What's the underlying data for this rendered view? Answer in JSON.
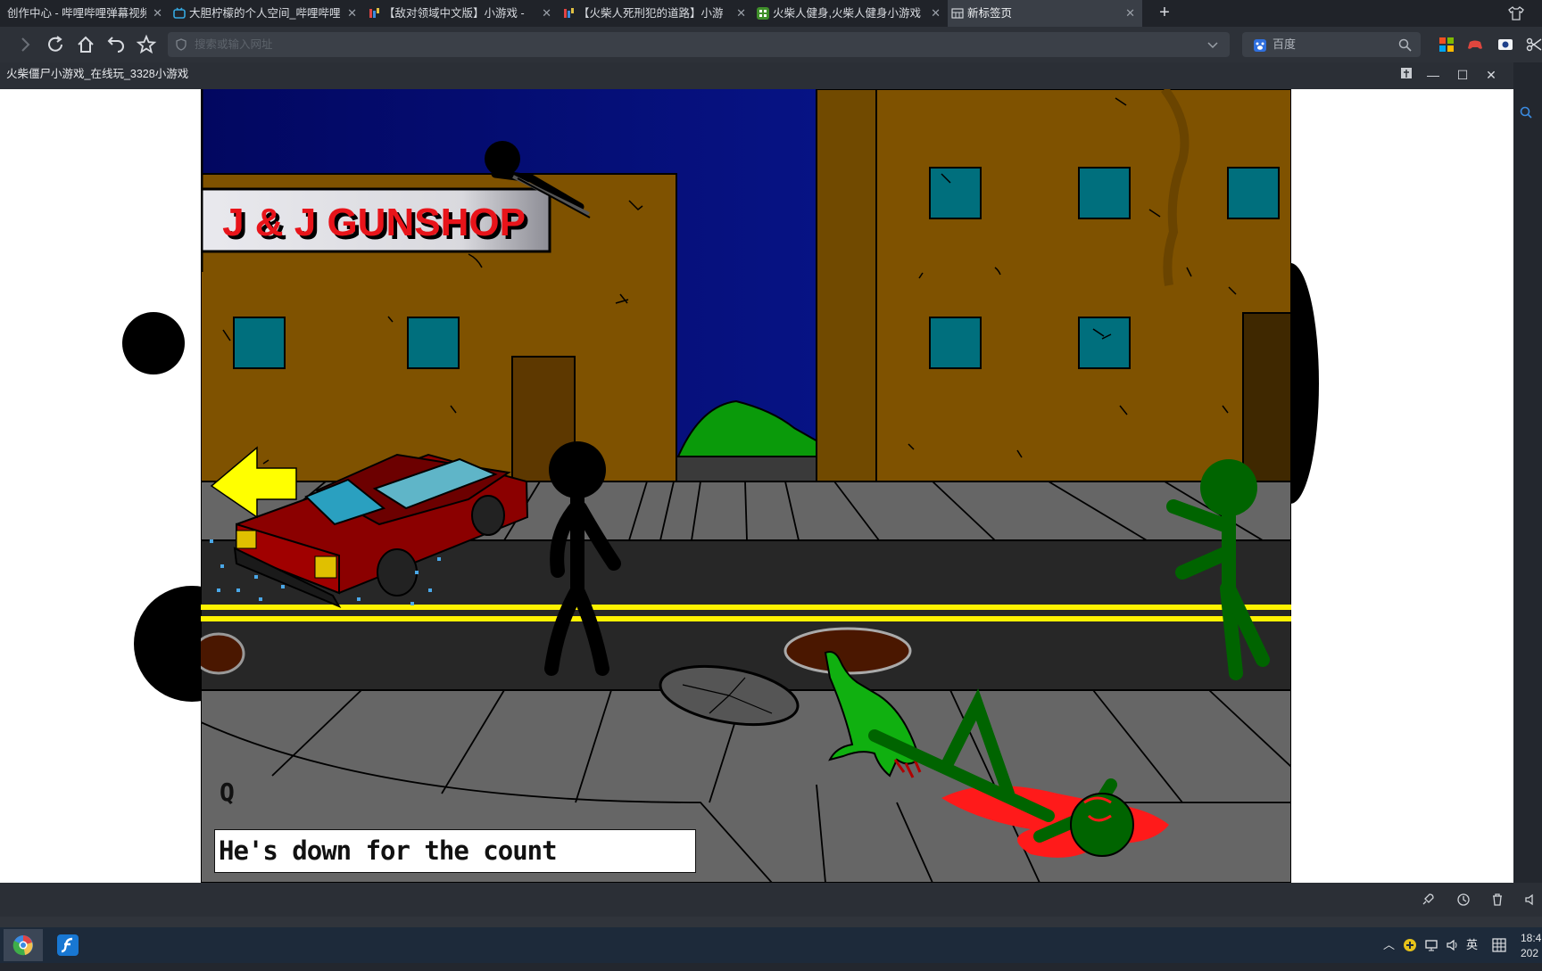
{
  "tabs": [
    {
      "label": "创作中心 - 哔哩哔哩弹幕视频",
      "icon": "bilibili-icon",
      "active": false
    },
    {
      "label": "大胆柠檬的个人空间_哔哩哔哩",
      "icon": "bilibili-tv-icon",
      "active": false
    },
    {
      "label": "【敌对领域中文版】小游戏 -",
      "icon": "game-site-icon",
      "active": false
    },
    {
      "label": "【火柴人死刑犯的道路】小游",
      "icon": "game-site-icon",
      "active": false
    },
    {
      "label": "火柴人健身,火柴人健身小游戏",
      "icon": "game-portal-icon",
      "active": false
    },
    {
      "label": "新标签页",
      "icon": "newtab-grid-icon",
      "active": true
    }
  ],
  "toolbar": {
    "url_placeholder": "搜索或输入网址",
    "search_engine_label": "百度"
  },
  "window": {
    "title": "火柴僵尸小游戏_在线玩_3328小游戏"
  },
  "game": {
    "shop_sign": "J & J GUNSHOP",
    "hint_key": "Q",
    "subtitle": "He's down for the count",
    "colors": {
      "sky_top": "#020760",
      "building": "#7f5200",
      "window_glass": "#006f7d",
      "road": "#272727",
      "sidewalk": "#666666",
      "road_line": "#fff200",
      "zombie": "#006400",
      "car": "#8b0000",
      "arrow": "#ffff00",
      "blood": "#ff1a1a"
    }
  },
  "tray": {
    "ime": "英",
    "time": "18:4",
    "date": "202"
  }
}
